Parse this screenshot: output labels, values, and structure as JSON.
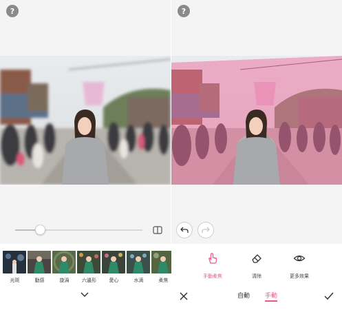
{
  "left": {
    "help_label": "?",
    "slider_value": 0.2,
    "filters": [
      {
        "label": "光斑",
        "tone": "#2b3a45"
      },
      {
        "label": "動感",
        "tone": "#45503a"
      },
      {
        "label": "旋渦",
        "tone": "#4a5b3a"
      },
      {
        "label": "六邊形",
        "tone": "#3e5636"
      },
      {
        "label": "愛心",
        "tone": "#41523a"
      },
      {
        "label": "水滴",
        "tone": "#3d5a45"
      },
      {
        "label": "柔焦",
        "tone": "#486040"
      }
    ]
  },
  "right": {
    "help_label": "?",
    "tools": [
      {
        "label": "手動柔焦",
        "icon": "hand-icon",
        "active": true
      },
      {
        "label": "清除",
        "icon": "eraser-icon",
        "active": false
      },
      {
        "label": "更多效果",
        "icon": "eye-icon",
        "active": false
      }
    ],
    "mode_auto": "自動",
    "mode_manual": "手動"
  },
  "colors": {
    "accent": "#e8588c",
    "overlay": "#f06b9a"
  }
}
